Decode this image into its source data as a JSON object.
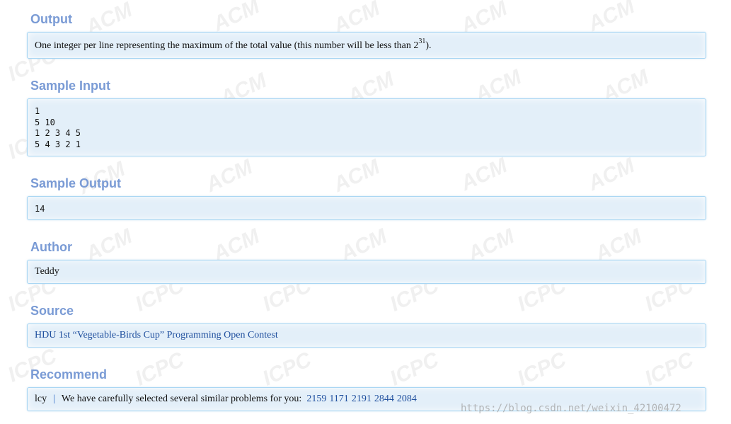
{
  "sections": {
    "output": {
      "title": "Output",
      "text": "One integer per line representing the maximum of the total value (this number will be less than 2",
      "sup": "31",
      "text_end": ")."
    },
    "sample_input": {
      "title": "Sample Input",
      "lines": [
        "1",
        "5 10",
        "1 2 3 4 5",
        "5 4 3 2 1"
      ]
    },
    "sample_output": {
      "title": "Sample Output",
      "value": "14"
    },
    "author": {
      "title": "Author",
      "value": "Teddy"
    },
    "source": {
      "title": "Source",
      "link_text": "HDU 1st “Vegetable-Birds Cup” Programming Open Contest"
    },
    "recommend": {
      "title": "Recommend",
      "user": "lcy",
      "separator": "|",
      "message": "We have carefully selected several similar problems for you:",
      "problems": [
        "2159",
        "1171",
        "2191",
        "2844",
        "2084"
      ]
    }
  },
  "watermark": {
    "url": "https://blog.csdn.net/weixin_42100472",
    "marks": [
      "ACM",
      "ICPC"
    ]
  },
  "colors": {
    "section_title": "#7a9bd5",
    "panel_bg": "#e3eff9",
    "panel_border": "#a9d6f3",
    "link": "#1f4f9e"
  }
}
